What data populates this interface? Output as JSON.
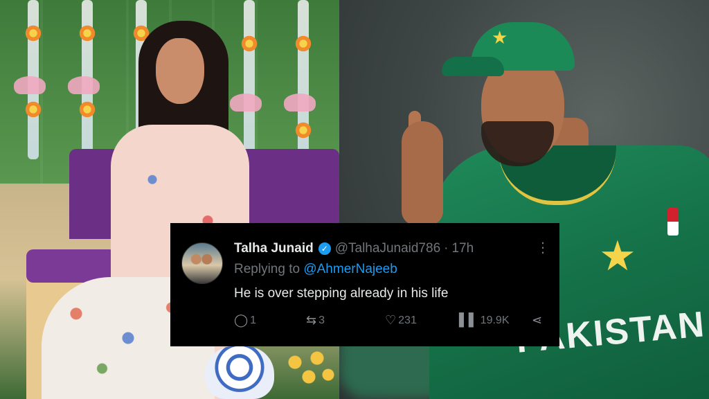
{
  "tweet": {
    "display_name": "Talha Junaid",
    "handle": "@TalhaJunaid786",
    "separator": "·",
    "time": "17h",
    "reply_prefix": "Replying to",
    "reply_to": "@AhmerNajeeb",
    "text": "He is over stepping already in his life",
    "replies": "1",
    "retweets": "3",
    "likes": "231",
    "views": "19.9K",
    "icons": {
      "verified": "verified-badge-icon",
      "more": "more-options-icon",
      "reply": "reply-icon",
      "retweet": "retweet-icon",
      "like": "heart-icon",
      "views": "views-chart-icon",
      "share": "share-icon"
    },
    "colors": {
      "background": "#000000",
      "text": "#e7e9ea",
      "muted": "#71767b",
      "link": "#1d9bf0"
    }
  },
  "right_photo": {
    "jersey_text": "PAKISTAN",
    "jersey_color": "#157148"
  }
}
